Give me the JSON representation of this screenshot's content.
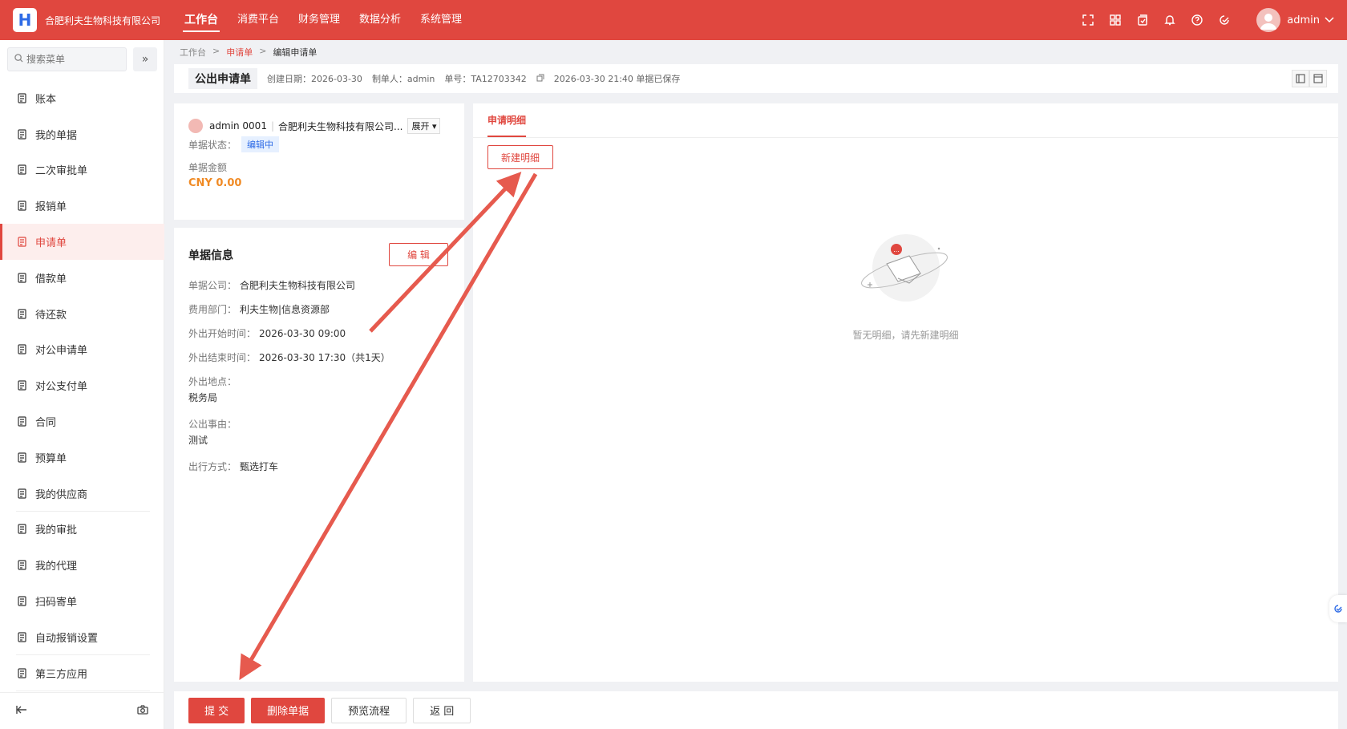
{
  "brand": {
    "logo": "H",
    "company": "合肥利夫生物科技有限公司"
  },
  "nav": [
    "工作台",
    "消费平台",
    "财务管理",
    "数据分析",
    "系统管理"
  ],
  "user": {
    "name": "admin"
  },
  "sidebar": {
    "search_placeholder": "搜索菜单",
    "items": [
      {
        "label": "账本",
        "icon": "ledger-icon"
      },
      {
        "label": "我的单据",
        "icon": "document-icon"
      },
      {
        "label": "二次审批单",
        "icon": "approval-doc-icon"
      },
      {
        "label": "报销单",
        "icon": "reimburse-icon"
      },
      {
        "label": "申请单",
        "icon": "application-icon"
      },
      {
        "label": "借款单",
        "icon": "loan-icon"
      },
      {
        "label": "待还款",
        "icon": "repay-icon"
      },
      {
        "label": "对公申请单",
        "icon": "corporate-apply-icon"
      },
      {
        "label": "对公支付单",
        "icon": "corporate-pay-icon"
      },
      {
        "label": "合同",
        "icon": "contract-icon"
      },
      {
        "label": "预算单",
        "icon": "budget-icon"
      },
      {
        "label": "我的供应商",
        "icon": "supplier-icon"
      },
      {
        "label": "我的审批",
        "icon": "my-approval-icon"
      },
      {
        "label": "我的代理",
        "icon": "proxy-icon"
      },
      {
        "label": "扫码寄单",
        "icon": "scan-icon"
      },
      {
        "label": "自动报销设置",
        "icon": "auto-settings-icon"
      },
      {
        "label": "第三方应用",
        "icon": "apps-grid-icon"
      }
    ]
  },
  "breadcrumb": [
    "工作台",
    "申请单",
    "编辑申请单"
  ],
  "titlebar": {
    "title": "公出申请单",
    "created": "创建日期：2026-03-30",
    "creator": "制单人：admin",
    "number": "单号：TA12703342",
    "saved": "2026-03-30 21:40 单据已保存"
  },
  "summary": {
    "user_line": "admin 0001",
    "company_short": "合肥利夫生物科技有限公司...",
    "expand": "展开",
    "status_label": "单据状态：",
    "status_value": "编辑中",
    "amount_label": "单据金额",
    "amount_value": "CNY 0.00"
  },
  "info": {
    "title": "单据信息",
    "edit_label": "编 辑",
    "company_label": "单据公司：",
    "company_value": "合肥利夫生物科技有限公司",
    "dept_label": "费用部门：",
    "dept_value": "利夫生物|信息资源部",
    "start_label": "外出开始时间：",
    "start_value": "2026-03-30 09:00",
    "end_label": "外出结束时间：",
    "end_value": "2026-03-30 17:30（共1天）",
    "place_label": "外出地点：",
    "place_value": "税务局",
    "reason_label": "公出事由：",
    "reason_value": "测试",
    "travel_label": "出行方式：",
    "travel_value": "甄选打车"
  },
  "detail": {
    "tab": "申请明细",
    "new_label": "新建明细",
    "empty_text": "暂无明细，请先新建明细"
  },
  "footer": {
    "submit": "提 交",
    "delete": "删除单据",
    "preview": "预览流程",
    "back": "返 回"
  },
  "colors": {
    "brand": "#e0473f",
    "amount": "#f08a24",
    "badge": "#2e6be6"
  }
}
